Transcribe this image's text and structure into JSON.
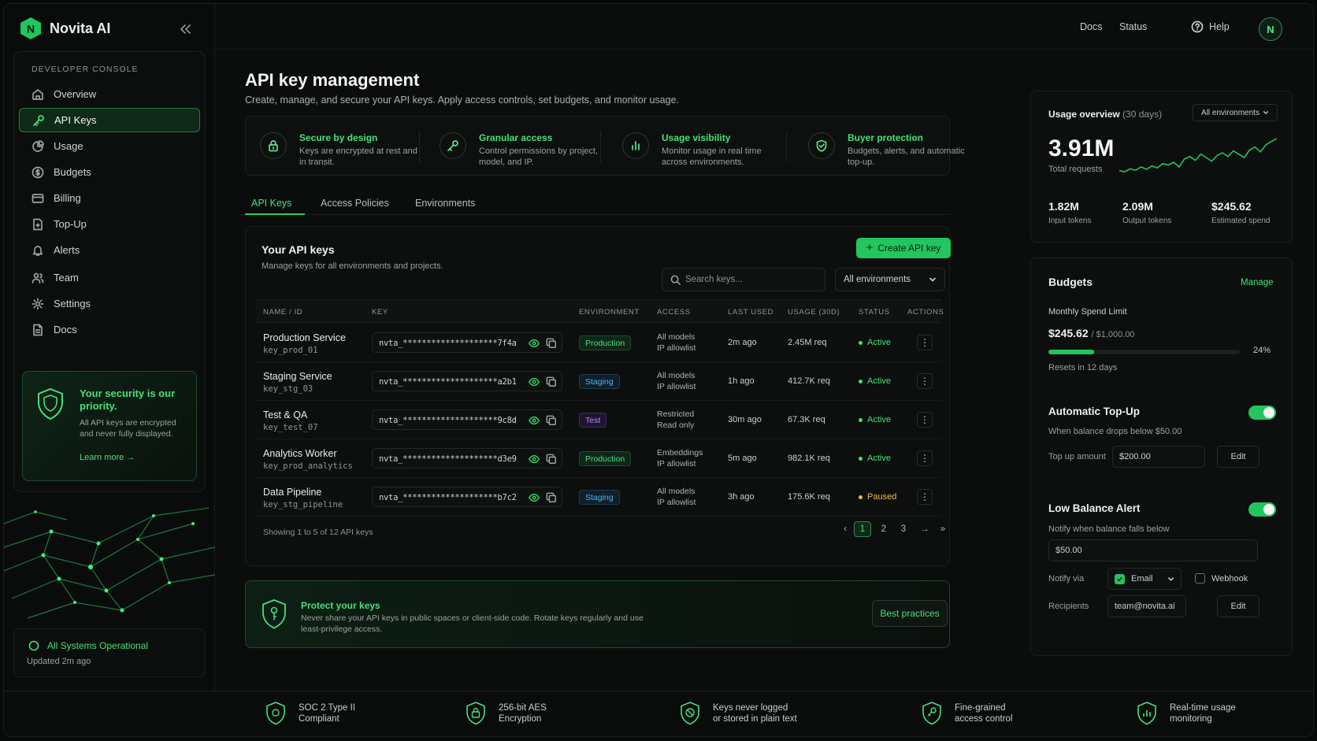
{
  "brand": {
    "name": "Novita AI",
    "logo_letter": "N"
  },
  "topbar": {
    "docs": "Docs",
    "status": "Status",
    "help": "Help",
    "avatar": "N"
  },
  "sidebar": {
    "heading": "DEVELOPER CONSOLE",
    "items": [
      {
        "label": "Overview",
        "icon": "home-icon"
      },
      {
        "label": "API Keys",
        "icon": "key-icon",
        "active": true
      },
      {
        "label": "Usage",
        "icon": "pie-chart-icon"
      },
      {
        "label": "Budgets",
        "icon": "dollar-icon"
      },
      {
        "label": "Billing",
        "icon": "card-icon"
      },
      {
        "label": "Top-Up",
        "icon": "wallet-icon"
      },
      {
        "label": "Alerts",
        "icon": "bell-icon"
      },
      {
        "label": "Team",
        "icon": "users-icon"
      },
      {
        "label": "Settings",
        "icon": "gear-icon"
      },
      {
        "label": "Docs",
        "icon": "doc-icon"
      }
    ],
    "security": {
      "title": "Your security is our priority.",
      "desc": "All API keys are encrypted and never fully displayed.",
      "link": "Learn more"
    },
    "status": {
      "title": "All Systems Operational",
      "updated": "Updated 2m ago"
    }
  },
  "page": {
    "title": "API key management",
    "subtitle": "Create, manage, and secure your API keys. Apply access controls, set budgets, and monitor usage."
  },
  "features": [
    {
      "title": "Secure by design",
      "desc": "Keys are encrypted at rest and in transit.",
      "icon": "lock-icon"
    },
    {
      "title": "Granular access",
      "desc": "Control permissions by project, model, and IP.",
      "icon": "key-icon"
    },
    {
      "title": "Usage visibility",
      "desc": "Monitor usage in real time across environments.",
      "icon": "bar-chart-icon"
    },
    {
      "title": "Buyer protection",
      "desc": "Budgets, alerts, and automatic top-up.",
      "icon": "shield-check-icon"
    }
  ],
  "tabs": [
    "API Keys",
    "Access Policies",
    "Environments"
  ],
  "keys_panel": {
    "title": "Your API keys",
    "subtitle": "Manage keys for all environments and projects.",
    "create_label": "Create API key",
    "search_placeholder": "Search keys...",
    "env_filter": "All environments",
    "columns": [
      "NAME / ID",
      "KEY",
      "ENVIRONMENT",
      "ACCESS",
      "LAST USED",
      "USAGE (30D)",
      "STATUS",
      "ACTIONS"
    ],
    "rows": [
      {
        "name": "Production Service",
        "id": "key_prod_01",
        "key": "nvta_********************7f4a",
        "env": "Production",
        "access1": "All models",
        "access2": "IP allowlist",
        "last_used": "2m ago",
        "usage": "2.45M req",
        "status": "Active"
      },
      {
        "name": "Staging Service",
        "id": "key_stg_03",
        "key": "nvta_********************a2b1",
        "env": "Staging",
        "access1": "All models",
        "access2": "IP allowlist",
        "last_used": "1h ago",
        "usage": "412.7K req",
        "status": "Active"
      },
      {
        "name": "Test & QA",
        "id": "key_test_07",
        "key": "nvta_********************9c8d",
        "env": "Test",
        "access1": "Restricted",
        "access2": "Read only",
        "last_used": "30m ago",
        "usage": "67.3K req",
        "status": "Active"
      },
      {
        "name": "Analytics Worker",
        "id": "key_prod_analytics",
        "key": "nvta_********************d3e9",
        "env": "Production",
        "access1": "Embeddings",
        "access2": "IP allowlist",
        "last_used": "5m ago",
        "usage": "982.1K req",
        "status": "Active"
      },
      {
        "name": "Data Pipeline",
        "id": "key_stg_pipeline",
        "key": "nvta_********************b7c2",
        "env": "Staging",
        "access1": "All models",
        "access2": "IP allowlist",
        "last_used": "3h ago",
        "usage": "175.6K req",
        "status": "Paused"
      }
    ],
    "showing": "Showing 1 to 5 of 12 API keys",
    "pages": [
      "1",
      "2",
      "3"
    ],
    "current_page": "1"
  },
  "protect": {
    "title": "Protect your keys",
    "desc": "Never share your API keys in public spaces or client-side code. Rotate keys regularly and use least-privilege access.",
    "button": "Best practices"
  },
  "usage_overview": {
    "title": "Usage overview",
    "period": "(30 days)",
    "filter": "All environments",
    "total": "3.91M",
    "total_label": "Total requests",
    "stats": [
      {
        "value": "1.82M",
        "label": "Input tokens"
      },
      {
        "value": "2.09M",
        "label": "Output tokens"
      },
      {
        "value": "$245.62",
        "label": "Estimated spend"
      }
    ],
    "trend": [
      30,
      28,
      34,
      31,
      38,
      33,
      40,
      36,
      45,
      42,
      48,
      38,
      55,
      60,
      52,
      65,
      58,
      50,
      62,
      68,
      60,
      72,
      65,
      58,
      74,
      80,
      70,
      85,
      92,
      98
    ]
  },
  "budgets": {
    "title": "Budgets",
    "manage": "Manage",
    "limit_label": "Monthly Spend Limit",
    "spent": "$245.62",
    "limit": "/ $1,000.00",
    "percent_label": "24%",
    "percent": 0.24,
    "resets": "Resets in 12 days",
    "topup": {
      "title": "Automatic Top-Up",
      "desc": "When balance drops below $50.00",
      "amount_label": "Top up amount",
      "amount": "$200.00",
      "edit": "Edit",
      "enabled": true
    },
    "alert": {
      "title": "Low Balance Alert",
      "desc": "Notify when balance falls below",
      "threshold": "$50.00",
      "notify_label": "Notify via",
      "email": "Email",
      "webhook": "Webhook",
      "recipients_label": "Recipients",
      "recipient": "team@novita.ai",
      "edit": "Edit",
      "enabled": true
    }
  },
  "footer": [
    {
      "line1": "SOC 2 Type II",
      "line2": "Compliant",
      "icon": "shield-icon"
    },
    {
      "line1": "256-bit AES",
      "line2": "Encryption",
      "icon": "lock-icon"
    },
    {
      "line1": "Keys never logged",
      "line2": "or stored in plain text",
      "icon": "no-log-icon"
    },
    {
      "line1": "Fine-grained",
      "line2": "access control",
      "icon": "key-icon"
    },
    {
      "line1": "Real-time usage",
      "line2": "monitoring",
      "icon": "bar-chart-icon"
    }
  ],
  "colors": {
    "accent": "#22c55e",
    "accent_text": "#46e07a",
    "background": "#0b0d0c",
    "production": "#46e07a",
    "staging": "#4cb3f0",
    "test": "#b48cf5",
    "paused": "#f5b93d"
  }
}
